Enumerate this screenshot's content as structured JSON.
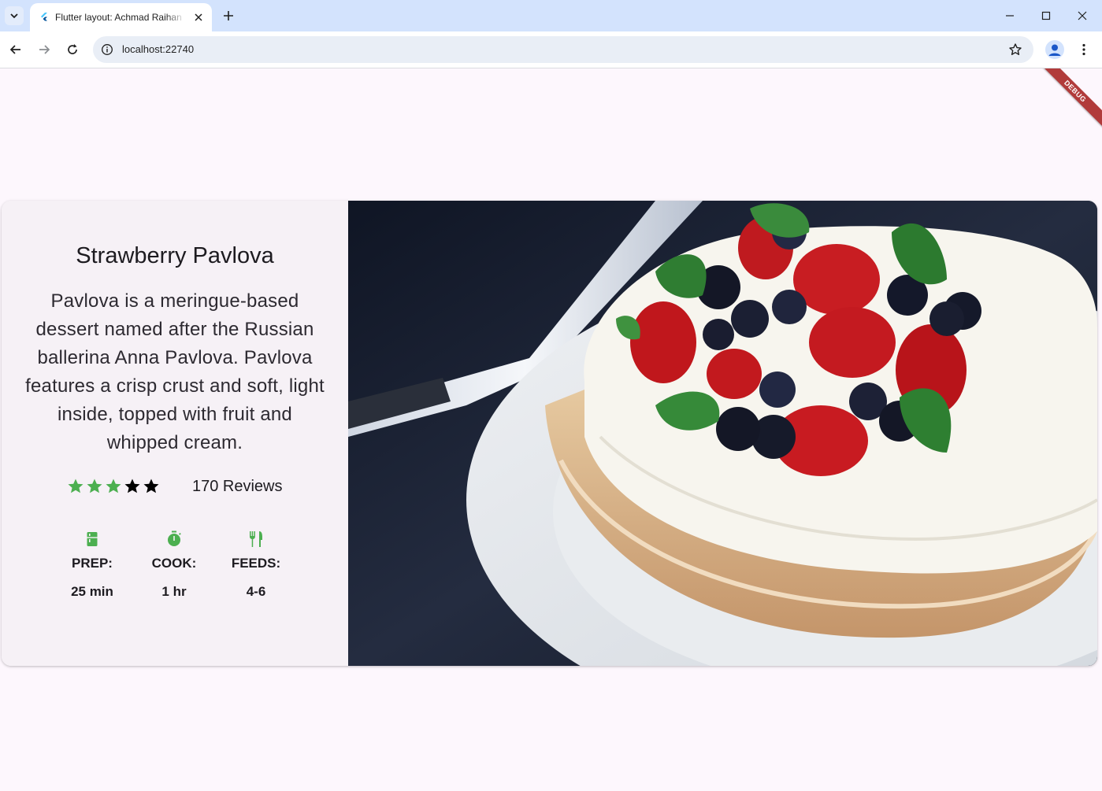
{
  "browser": {
    "tab_title": "Flutter layout: Achmad Raihan Fahrezi",
    "url": "localhost:22740"
  },
  "page": {
    "debug_banner": "DEBUG"
  },
  "recipe": {
    "title": "Strawberry Pavlova",
    "description": "Pavlova is a meringue-based dessert named after the Russian ballerina Anna Pavlova. Pavlova features a crisp crust and soft, light inside, topped with fruit and whipped cream.",
    "rating": {
      "value": 3,
      "out_of": 5
    },
    "reviews": "170 Reviews",
    "info": [
      {
        "icon": "kitchen-icon",
        "label": "PREP:",
        "value": "25 min"
      },
      {
        "icon": "timer-icon",
        "label": "COOK:",
        "value": "1 hr"
      },
      {
        "icon": "restaurant-icon",
        "label": "FEEDS:",
        "value": "4-6"
      }
    ],
    "image_subject": "strawberry pavlova photo"
  },
  "colors": {
    "accent_green": "#4caf50",
    "star_inactive": "#000000",
    "page_bg": "#fdf7fd",
    "card_bg": "#f6f1f6",
    "tabstrip_bg": "#d3e3fd",
    "debug_banner": "#b13b3b"
  }
}
